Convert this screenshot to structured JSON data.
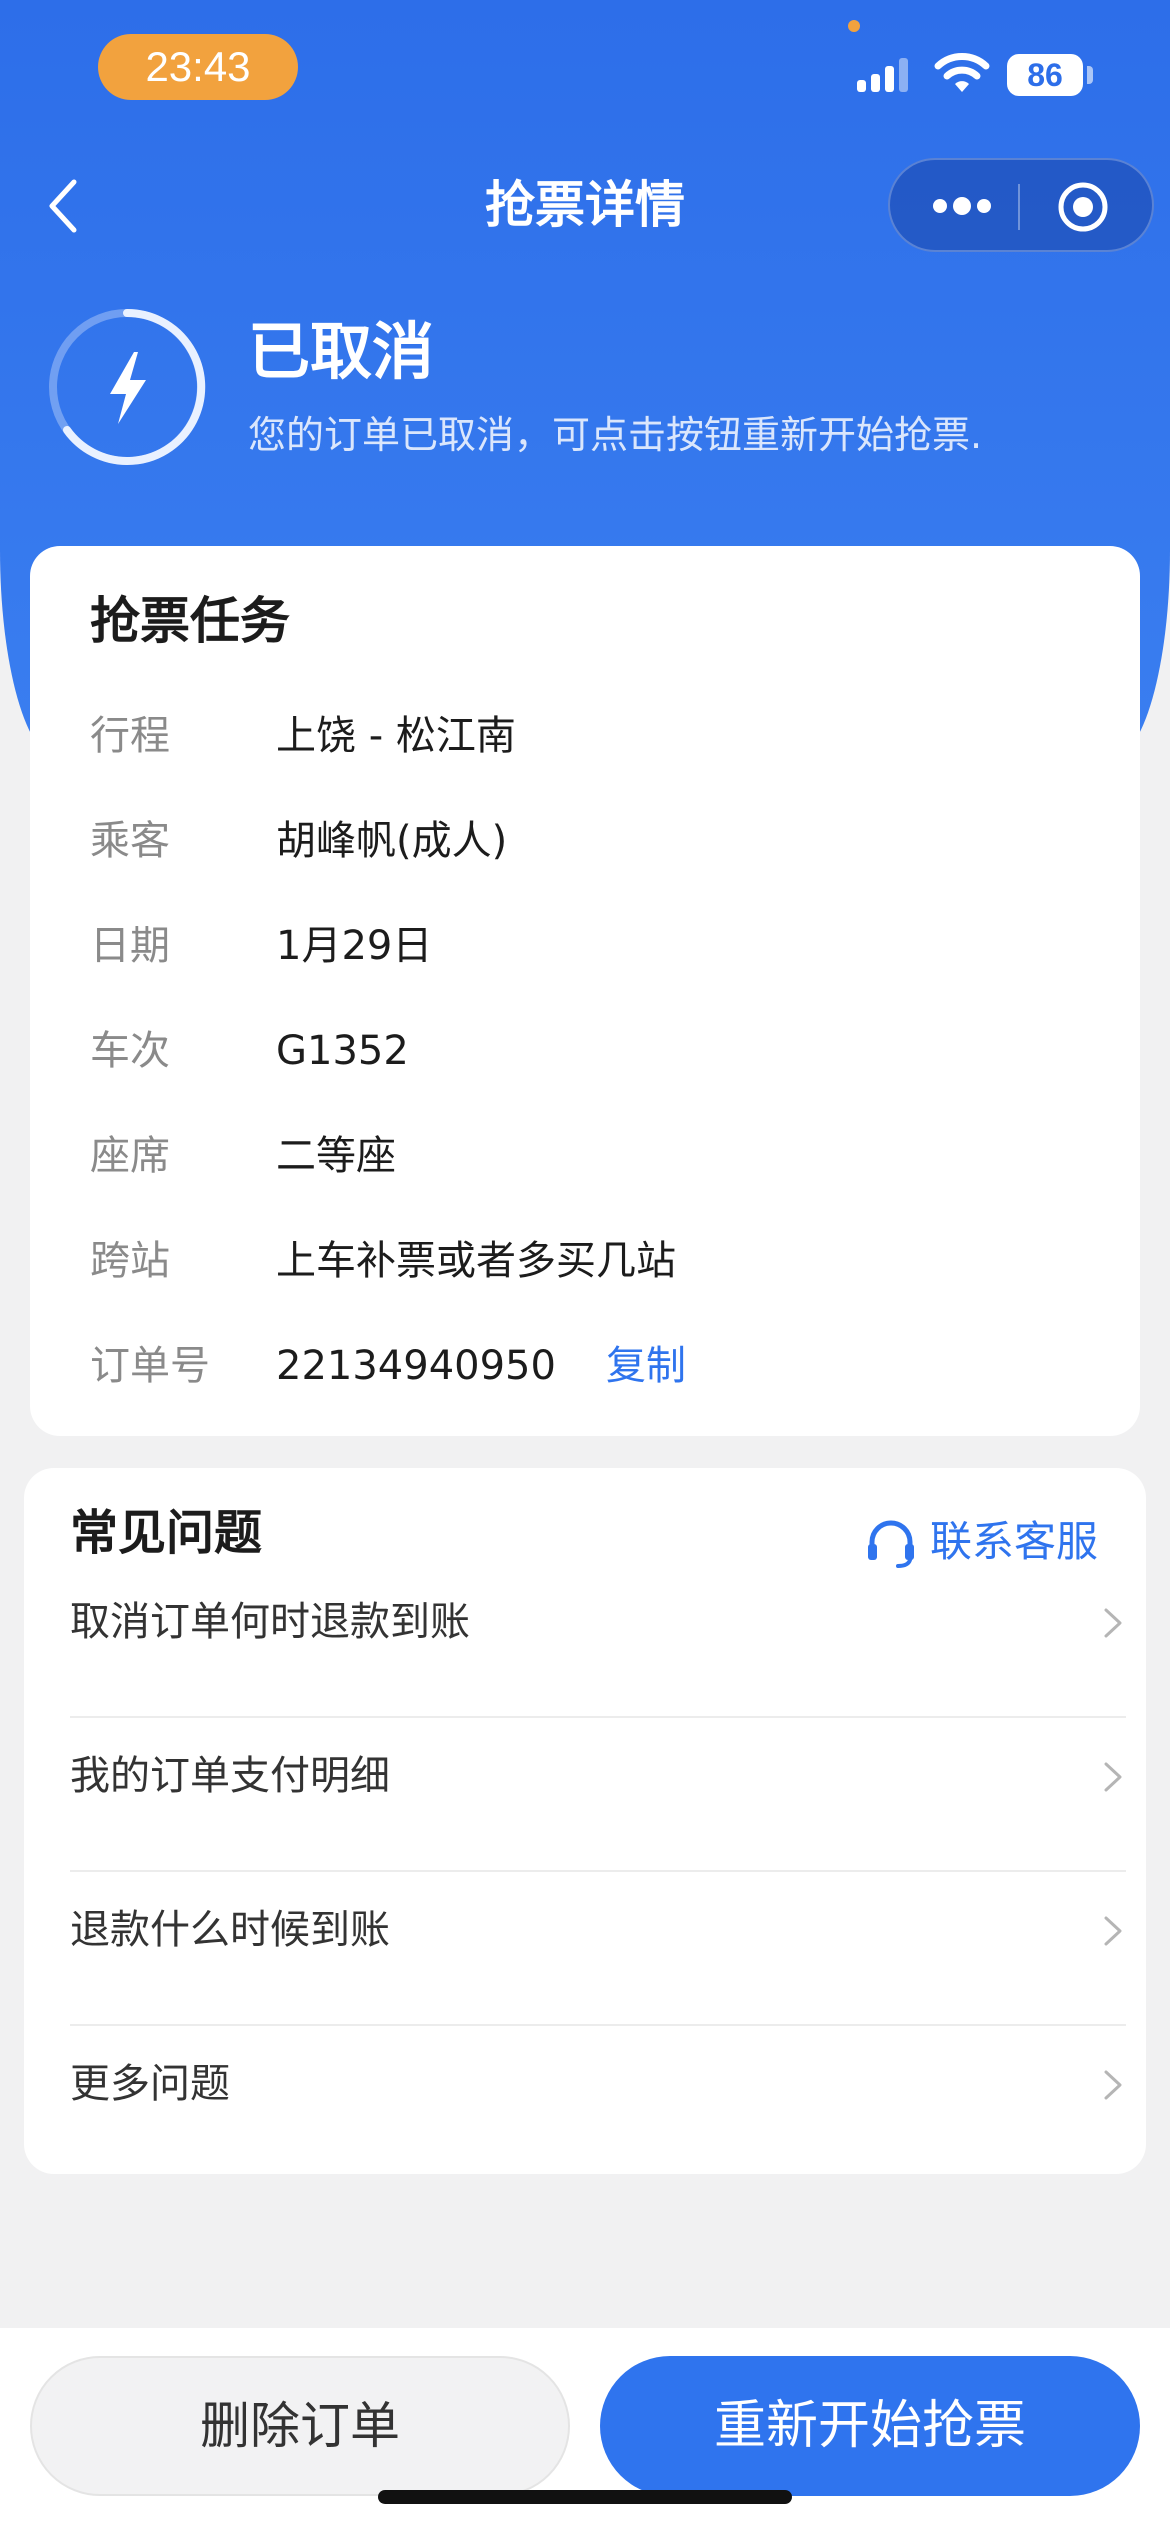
{
  "status_bar": {
    "time": "23:43",
    "battery": "86"
  },
  "nav": {
    "title": "抢票详情"
  },
  "status": {
    "title": "已取消",
    "description": "您的订单已取消，可点击按钮重新开始抢票."
  },
  "task": {
    "title": "抢票任务",
    "rows": [
      {
        "label": "行程",
        "value": "上饶 - 松江南"
      },
      {
        "label": "乘客",
        "value": "胡峰帆(成人)"
      },
      {
        "label": "日期",
        "value": "1月29日"
      },
      {
        "label": "车次",
        "value": "G1352"
      },
      {
        "label": "座席",
        "value": "二等座"
      },
      {
        "label": "跨站",
        "value": "上车补票或者多买几站"
      },
      {
        "label": "订单号",
        "value": "22134940950"
      }
    ],
    "copy_label": "复制"
  },
  "faq": {
    "title": "常见问题",
    "contact_label": "联系客服",
    "items": [
      "取消订单何时退款到账",
      "我的订单支付明细",
      "退款什么时候到账",
      "更多问题"
    ]
  },
  "actions": {
    "delete_label": "删除订单",
    "restart_label": "重新开始抢票"
  },
  "colors": {
    "header_blue": "#2d6ee9",
    "accent": "#2f74ee",
    "time_pill": "#f2a23e"
  }
}
